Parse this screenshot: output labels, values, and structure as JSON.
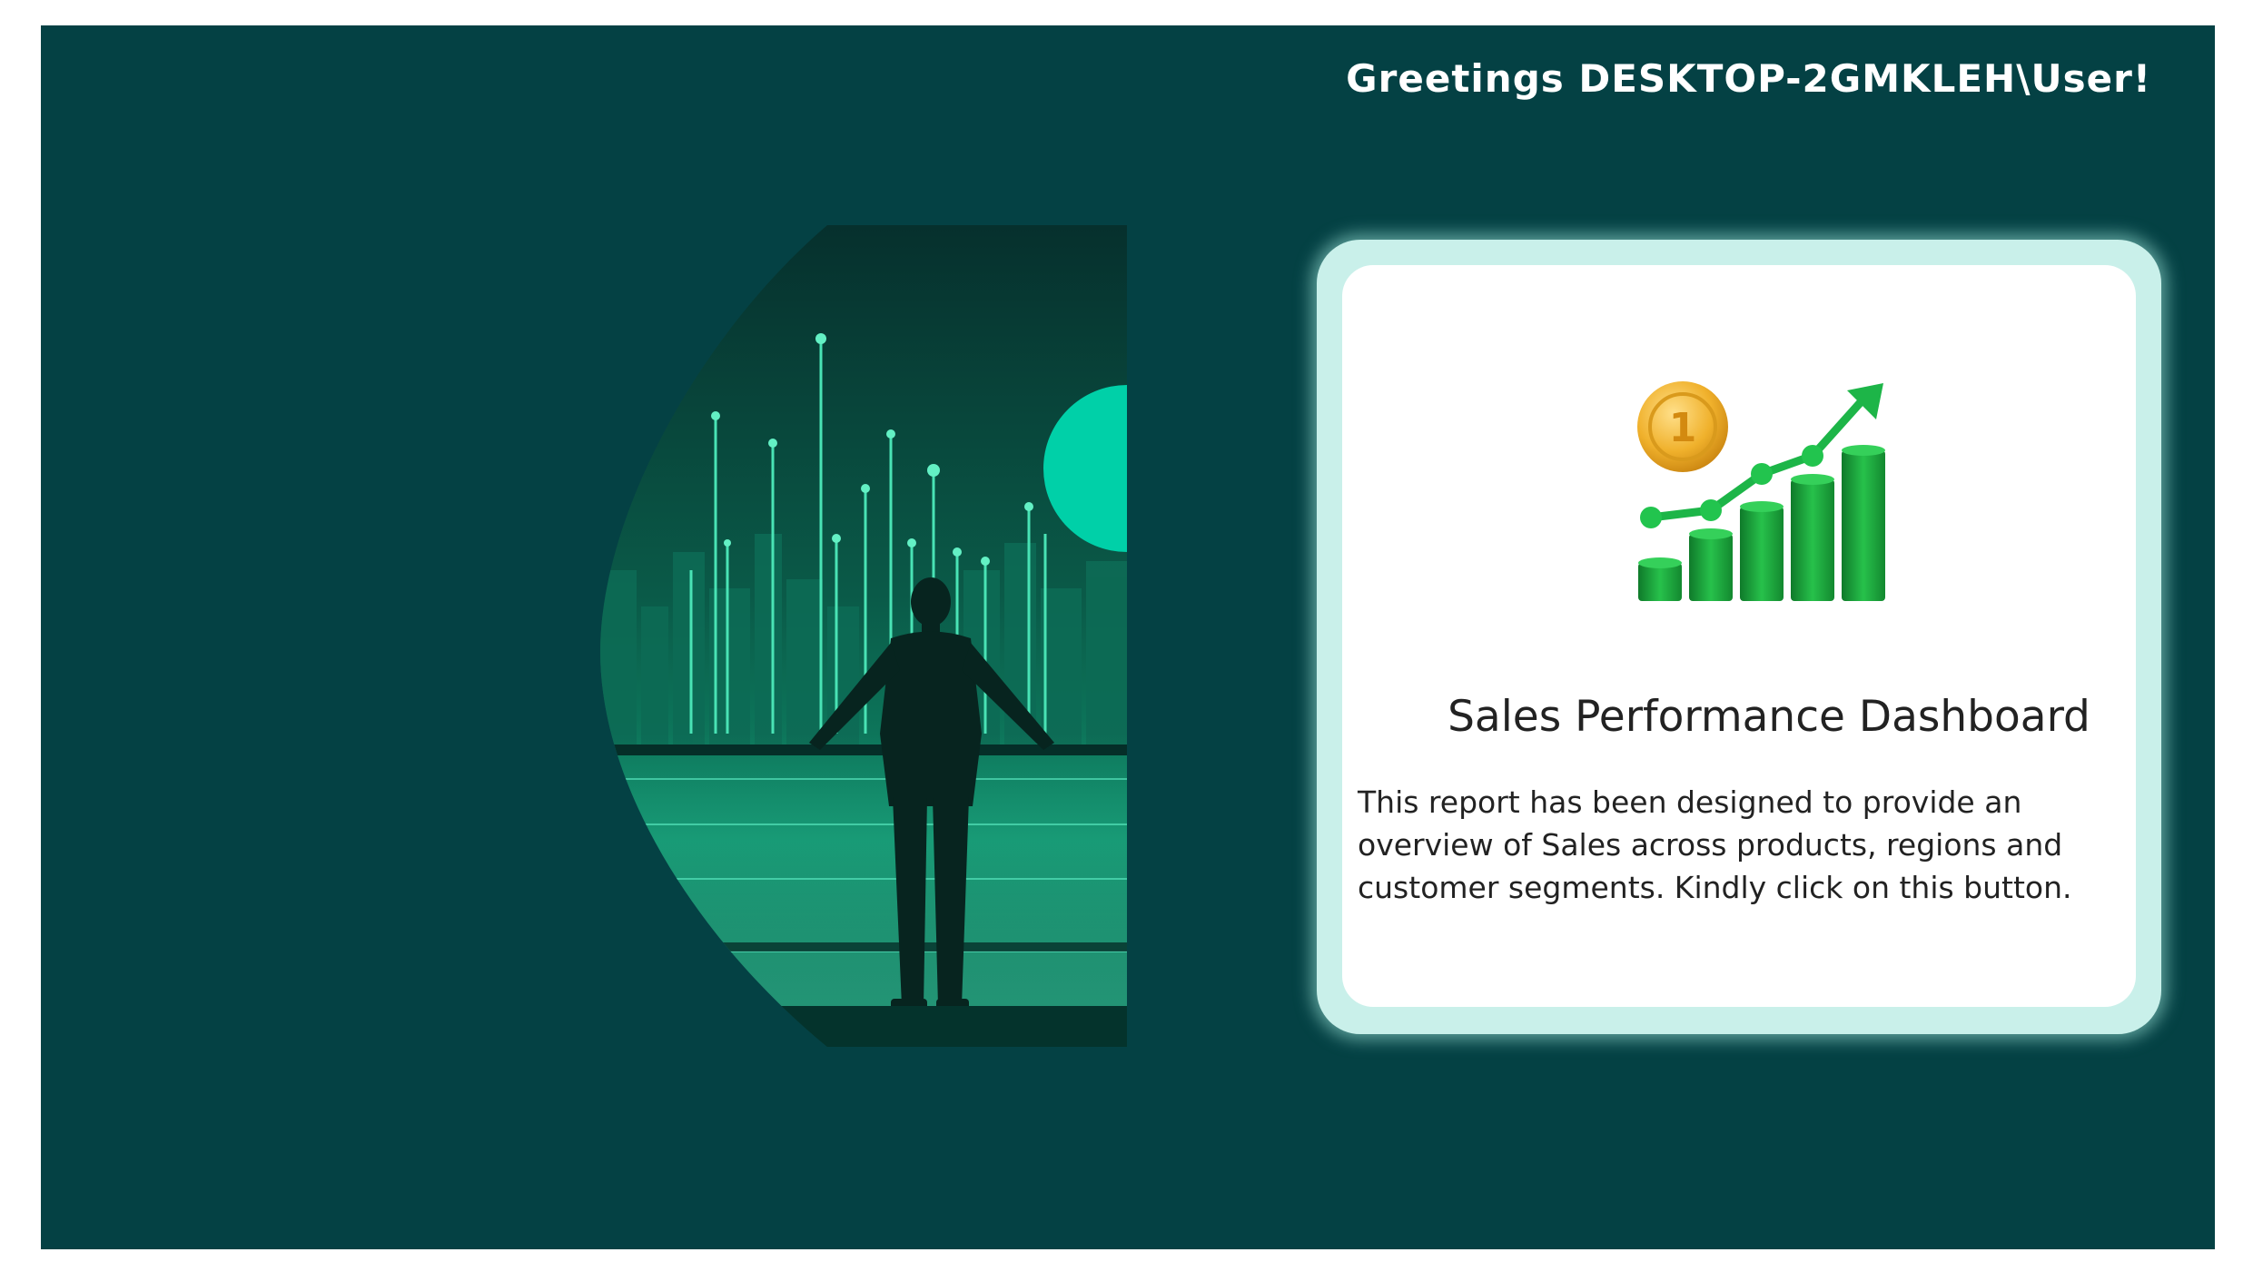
{
  "header": {
    "greeting": "Greetings DESKTOP-2GMKLEH\\User!"
  },
  "hero": {
    "icon": "businessman-city-skyline-image"
  },
  "card": {
    "title": "Sales Performance Dashboard",
    "description": "This report has been designed to provide an overview of Sales across products, regions and customer segments. Kindly click on this button.",
    "illustration": "sales-growth-chart-icon",
    "medal_label": "1"
  },
  "colors": {
    "background": "#044144",
    "card_border": "#c9f0ea",
    "accent": "#00d0a8",
    "chart_green": "#1fae3f"
  }
}
